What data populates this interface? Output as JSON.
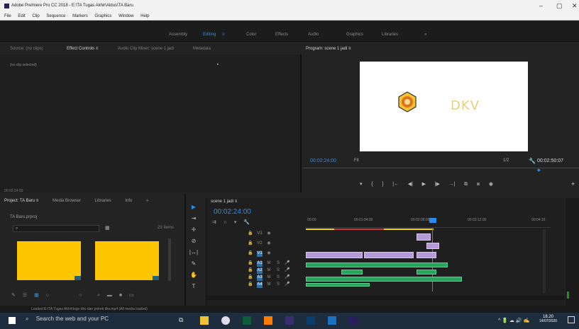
{
  "window": {
    "title": "Adobe Premiere Pro CC 2018 - E:\\TA Tugas Akhir\\Aldus\\TA Baru",
    "minimize": "–",
    "maximize": "▢",
    "close": "✕"
  },
  "menu": [
    "File",
    "Edit",
    "Clip",
    "Sequence",
    "Markers",
    "Graphics",
    "Window",
    "Help"
  ],
  "workspaces": [
    {
      "label": "Assembly",
      "active": false
    },
    {
      "label": "Editing",
      "active": true
    },
    {
      "label": "Color",
      "active": false
    },
    {
      "label": "Effects",
      "active": false
    },
    {
      "label": "Audio",
      "active": false
    },
    {
      "label": "Graphics",
      "active": false
    },
    {
      "label": "Libraries",
      "active": false
    },
    {
      "label": "»",
      "active": false
    }
  ],
  "source_panel": {
    "tabs": [
      "Source: (no clips)",
      "Effect Controls ≡",
      "Audio Clip Mixer: scene 1 jadi",
      "Metadata"
    ],
    "no_clip": "(no clip selected)",
    "timecode": "00:02:24:00"
  },
  "program": {
    "label": "Program: scene 1 jadi ≡",
    "timecode": "00:02:24:00",
    "fit": "Fit",
    "quality": "1/2",
    "duration": "00:02:50:07",
    "watermark": "DKV",
    "transport": [
      "▾",
      "{",
      "}",
      "|←",
      "◀|",
      "▶",
      "|▶",
      "→|",
      "⧉",
      "⧈",
      "◉"
    ],
    "add": "+"
  },
  "project": {
    "tabs": [
      "Project: TA Baru ≡",
      "Media Browser",
      "Libraries",
      "Info",
      "»"
    ],
    "file": "TA Baru.prproj",
    "items": "23 Items",
    "bottom_icons": [
      "✎",
      "☰",
      "▦",
      "○",
      "○",
      "⌕",
      "▬",
      "■",
      "▭"
    ]
  },
  "tools": [
    "▶",
    "⇥",
    "✛",
    "⊘",
    "|↔|",
    "✎",
    "✋",
    "T"
  ],
  "timeline": {
    "sequence": "scene 1 jadi ≡",
    "timecode": "00:02:24:00",
    "ticks": [
      "00:00",
      "00:01:04:00",
      "00:02:08:00",
      "00:03:12:00",
      "00:04:16"
    ],
    "tracks": [
      {
        "name": "V3"
      },
      {
        "name": "V2"
      },
      {
        "name": "V1"
      },
      {
        "name": "A1"
      },
      {
        "name": "A2"
      },
      {
        "name": "A3"
      },
      {
        "name": "A4"
      }
    ]
  },
  "status": "Loaded E:\\TA Tugas Akhir\\logo dkv dan polrek dkv.mp4 (All media loaded)",
  "taskbar": {
    "search": "Search the web and your PC",
    "time": "18.20",
    "date": "14/07/2020",
    "tray": "^ 🔋 ☁ 🔊 ✍"
  }
}
